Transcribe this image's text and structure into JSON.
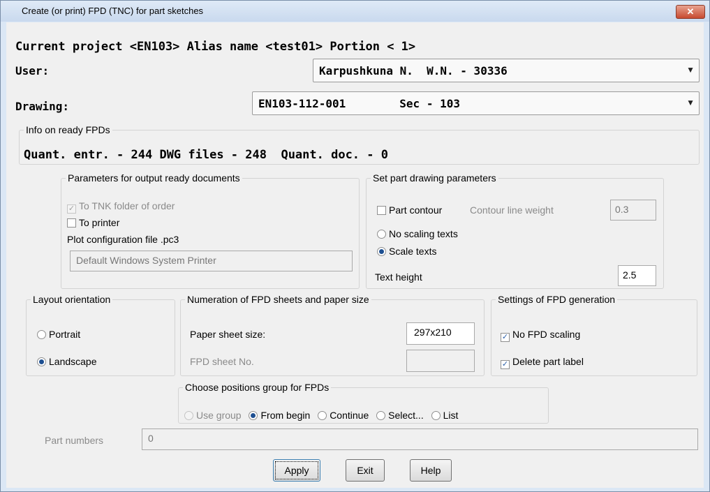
{
  "window": {
    "title": "Create (or print) FPD (TNC) for part sketches",
    "close_symbol": "✕"
  },
  "header": {
    "project_line": "Current project <EN103> Alias name <test01> Portion < 1>"
  },
  "user": {
    "label": "User:",
    "value": "Karpushkuna N.  W.N. - 30336"
  },
  "drawing": {
    "label": "Drawing:",
    "value": "EN103-112-001        Sec - 103"
  },
  "info": {
    "legend": "Info on ready FPDs",
    "text": "Quant. entr. - 244 DWG files - 248  Quant. doc. - 0"
  },
  "output_params": {
    "legend": "Parameters for output ready documents",
    "to_tnk": "To TNK folder of order",
    "to_printer": "To printer",
    "plot_config_label": "Plot configuration file .pc3",
    "plot_config_value": "Default Windows System Printer"
  },
  "part_drawing": {
    "legend": "Set part drawing parameters",
    "part_contour": "Part contour",
    "contour_weight_label": "Contour line weight",
    "contour_weight_value": "0.3",
    "no_scaling_texts": "No scaling texts",
    "scale_texts": "Scale texts",
    "text_height_label": "Text height",
    "text_height_value": "2.5"
  },
  "layout": {
    "legend": "Layout orientation",
    "portrait": "Portrait",
    "landscape": "Landscape"
  },
  "numeration": {
    "legend": "Numeration of FPD sheets and paper size",
    "paper_size_label": "Paper sheet size:",
    "paper_size_value": "297x210",
    "sheet_no_label": "FPD sheet No.",
    "sheet_no_value": ""
  },
  "settings": {
    "legend": "Settings of FPD generation",
    "no_scaling": "No FPD scaling",
    "delete_label": "Delete part label"
  },
  "positions": {
    "legend": "Choose positions group for FPDs",
    "use_group": "Use group",
    "from_begin": "From begin",
    "continue": "Continue",
    "select": "Select...",
    "list": "List"
  },
  "part_numbers": {
    "label": "Part numbers",
    "value": "0"
  },
  "buttons": {
    "apply": "Apply",
    "exit": "Exit",
    "help": "Help"
  },
  "icons": {
    "check": "✓",
    "dropdown": "▼"
  },
  "colors": {
    "window_frame": "#dbe7f5",
    "client_bg": "#f0f0f0",
    "close_button": "#c74a30"
  }
}
